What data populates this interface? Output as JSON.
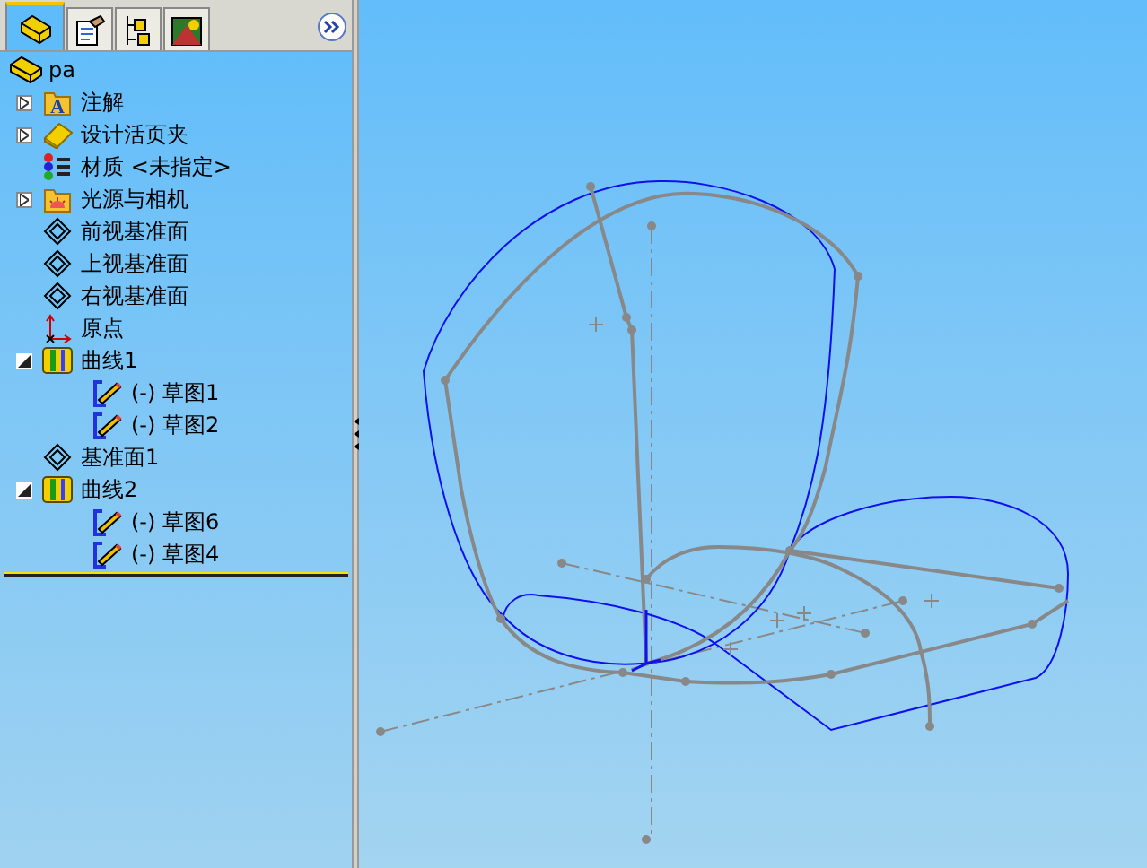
{
  "panel_tabs": [
    {
      "kind": "feature-tree",
      "selected": true
    },
    {
      "kind": "property",
      "selected": false
    },
    {
      "kind": "config",
      "selected": false
    },
    {
      "kind": "display",
      "selected": false
    }
  ],
  "tree": {
    "root": {
      "label": "pa",
      "kind": "part"
    },
    "items": [
      {
        "label": "注解",
        "kind": "annotations",
        "icon_text": "A",
        "expanded": false
      },
      {
        "label": "设计活页夹",
        "kind": "binder",
        "expanded": false
      },
      {
        "label": "材质 <未指定>",
        "kind": "material"
      },
      {
        "label": "光源与相机",
        "kind": "lights",
        "expanded": false
      },
      {
        "label": "前视基准面",
        "kind": "plane"
      },
      {
        "label": "上视基准面",
        "kind": "plane"
      },
      {
        "label": "右视基准面",
        "kind": "plane"
      },
      {
        "label": "原点",
        "kind": "origin"
      },
      {
        "label": "曲线1",
        "kind": "curve",
        "expanded": true,
        "children": [
          {
            "label": "(-) 草图1",
            "kind": "sketch"
          },
          {
            "label": "(-) 草图2",
            "kind": "sketch"
          }
        ]
      },
      {
        "label": "基准面1",
        "kind": "plane"
      },
      {
        "label": "曲线2",
        "kind": "curve",
        "expanded": true,
        "children": [
          {
            "label": "(-) 草图6",
            "kind": "sketch"
          },
          {
            "label": "(-) 草图4",
            "kind": "sketch"
          }
        ]
      }
    ]
  }
}
